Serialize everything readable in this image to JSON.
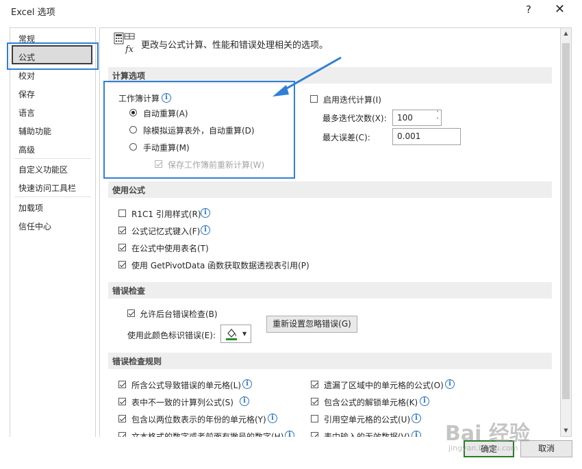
{
  "window": {
    "title": "Excel 选项",
    "help": "?",
    "close": "✕"
  },
  "sidebar": {
    "items": [
      "常规",
      "公式",
      "校对",
      "保存",
      "语言",
      "辅助功能",
      "高级",
      "自定义功能区",
      "快速访问工具栏",
      "加载项",
      "信任中心"
    ]
  },
  "header": {
    "text": "更改与公式计算、性能和错误处理相关的选项。",
    "icon": "formula-icon"
  },
  "calc": {
    "section": "计算选项",
    "workbook_label": "工作簿计算",
    "auto": "自动重算(A)",
    "auto_except": "除模拟运算表外，自动重算(D)",
    "manual": "手动重算(M)",
    "recalc_before_save": "保存工作簿前重新计算(W)",
    "iterative": "启用迭代计算(I)",
    "max_iter_label": "最多迭代次数(X):",
    "max_iter_value": "100",
    "max_change_label": "最大误差(C):",
    "max_change_value": "0.001"
  },
  "formulas": {
    "section": "使用公式",
    "r1c1": "R1C1 引用样式(R)",
    "autocomplete": "公式记忆式键入(F)",
    "table_names": "在公式中使用表名(T)",
    "pivotdata": "使用 GetPivotData 函数获取数据透视表引用(P)"
  },
  "errors": {
    "section": "错误检查",
    "background": "允许后台错误检查(B)",
    "color_label": "使用此颜色标识错误(E):",
    "reset_button": "重新设置忽略错误(G)",
    "indicator_color": "#2e8b2e"
  },
  "rules": {
    "section": "错误检查规则",
    "left": [
      "所含公式导致错误的单元格(L)",
      "表中不一致的计算列公式(S)",
      "包含以两位数表示的年份的单元格(Y)",
      "文本格式的数字或者前面有撇号的数字(H)"
    ],
    "right": [
      "遗漏了区域中的单元格的公式(O)",
      "包含公式的解锁单元格(K)",
      "引用空单元格的公式(U)",
      "表中输入的无效数据(V)"
    ]
  },
  "footer": {
    "ok": "确定",
    "cancel": "取消"
  },
  "watermark": {
    "text": "Bai 经验",
    "sub": "jingyan.baidu.com"
  },
  "colors": {
    "highlight": "#2f7fd6",
    "info": "#2c72c7",
    "section_bg": "#eeeeee"
  }
}
